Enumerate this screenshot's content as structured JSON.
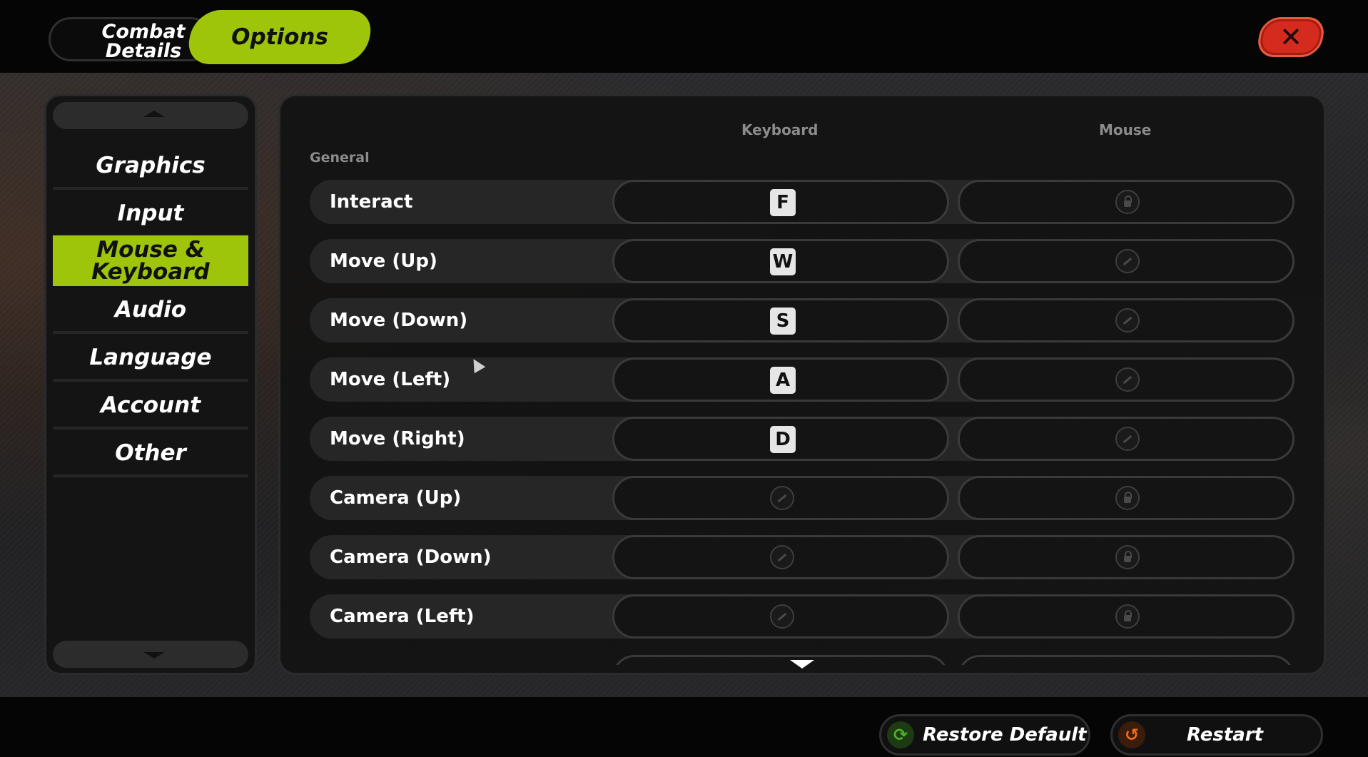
{
  "tabs": {
    "combat_details": "Combat\nDetails",
    "options": "Options"
  },
  "close": "✕",
  "sidebar": {
    "items": [
      {
        "label": "Graphics"
      },
      {
        "label": "Input"
      },
      {
        "label": "Mouse &\nKeyboard"
      },
      {
        "label": "Audio"
      },
      {
        "label": "Language"
      },
      {
        "label": "Account"
      },
      {
        "label": "Other"
      }
    ],
    "active_index": 2
  },
  "columns": {
    "keyboard": "Keyboard",
    "mouse": "Mouse"
  },
  "section": "General",
  "bindings": [
    {
      "action": "Interact",
      "keyboard": "F",
      "mouse": "lock-icon"
    },
    {
      "action": "Move (Up)",
      "keyboard": "W",
      "mouse": "unbound-icon"
    },
    {
      "action": "Move (Down)",
      "keyboard": "S",
      "mouse": "unbound-icon"
    },
    {
      "action": "Move (Left)",
      "keyboard": "A",
      "mouse": "unbound-icon"
    },
    {
      "action": "Move (Right)",
      "keyboard": "D",
      "mouse": "unbound-icon"
    },
    {
      "action": "Camera (Up)",
      "keyboard": "unbound-icon",
      "mouse": "lock-icon"
    },
    {
      "action": "Camera (Down)",
      "keyboard": "unbound-icon",
      "mouse": "lock-icon"
    },
    {
      "action": "Camera (Left)",
      "keyboard": "unbound-icon",
      "mouse": "lock-icon"
    }
  ],
  "footer": {
    "restore_default": "Restore Default",
    "restart": "Restart",
    "restore_icon": "refresh-icon",
    "restart_icon": "undo-icon"
  },
  "colors": {
    "accent": "#9fc50b",
    "close": "#d52b1e",
    "restore_icon": "#4caf2a",
    "restart_icon": "#f06a1a"
  }
}
